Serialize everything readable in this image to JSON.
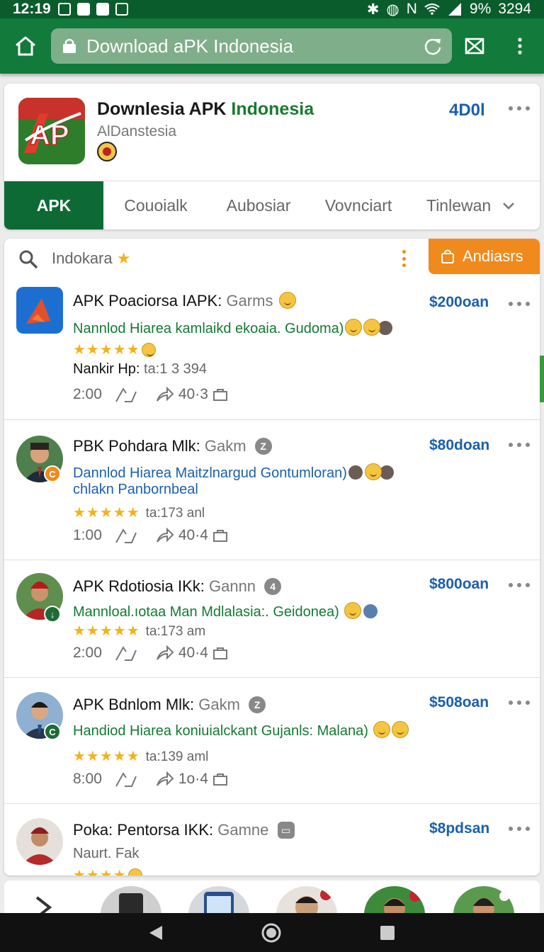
{
  "status": {
    "time": "12:19",
    "right": "9%",
    "battery_text": "3294"
  },
  "browser": {
    "url": "Download aPK Indonesia"
  },
  "app": {
    "title_part1": "Downlesia APK ",
    "title_part2": "Indonesia",
    "subtitle": "AlDanstesia",
    "count": "4D0l",
    "accent": "#0d6a35"
  },
  "tabs": [
    "APK",
    "Couoialk",
    "Aubosiar",
    "Vovnciart",
    "Tinlewan"
  ],
  "search": {
    "text": "Indokara",
    "cta": "Andiasrs"
  },
  "items": [
    {
      "title": "APK Poaciorsa IAPK: ",
      "title_muted": "Garms",
      "price": "$200oan",
      "desc1": "Nannlod Hiarea kamlaikd ekoaia. Gudoma)",
      "meta_label": "Nankir Hp: ",
      "meta_value": "ta:1 3 394",
      "time": "2:00",
      "share": "40·3"
    },
    {
      "title": "PBK Pohdara Mlk: ",
      "title_muted": "Gakm",
      "badge": "Z",
      "price": "$80doan",
      "desc1": "Dannlod Hiarea Maitzlnargud Gontumloran)",
      "desc2": "chlakn Panbornbeal",
      "rating_text": "ta:173 anl",
      "time": "1:00",
      "share": "40·4"
    },
    {
      "title": "APK Rdotiosia IKk: ",
      "title_muted": "Gannn",
      "badge": "4",
      "price": "$800oan",
      "desc1": "Mannloal.ıotaa Man Mdlalasia:. Geidonea)",
      "rating_text": "ta:173 am",
      "time": "2:00",
      "share": "40·4"
    },
    {
      "title": "APK Bdnlom Mlk: ",
      "title_muted": "Gakm",
      "badge": "Z",
      "price": "$508oan",
      "desc1": "Handiod Hiarea koniuialckant Gujanls: Malana)",
      "rating_text": "ta:139 aml",
      "time": "8:00",
      "share": "1o·4"
    },
    {
      "title": "Poka: Pentorsa IKK: ",
      "title_muted": "Gamne",
      "price": "$8pdsan",
      "desc1": "Naurt. Fak"
    }
  ],
  "icons": {
    "home": "home-icon",
    "lock": "lock-icon",
    "reload": "reload-icon",
    "mail": "mail-icon",
    "menu": "more-vert-icon",
    "search": "search-icon",
    "back": "nav-back-icon",
    "home_nav": "nav-home-icon",
    "recents": "nav-recents-icon"
  }
}
